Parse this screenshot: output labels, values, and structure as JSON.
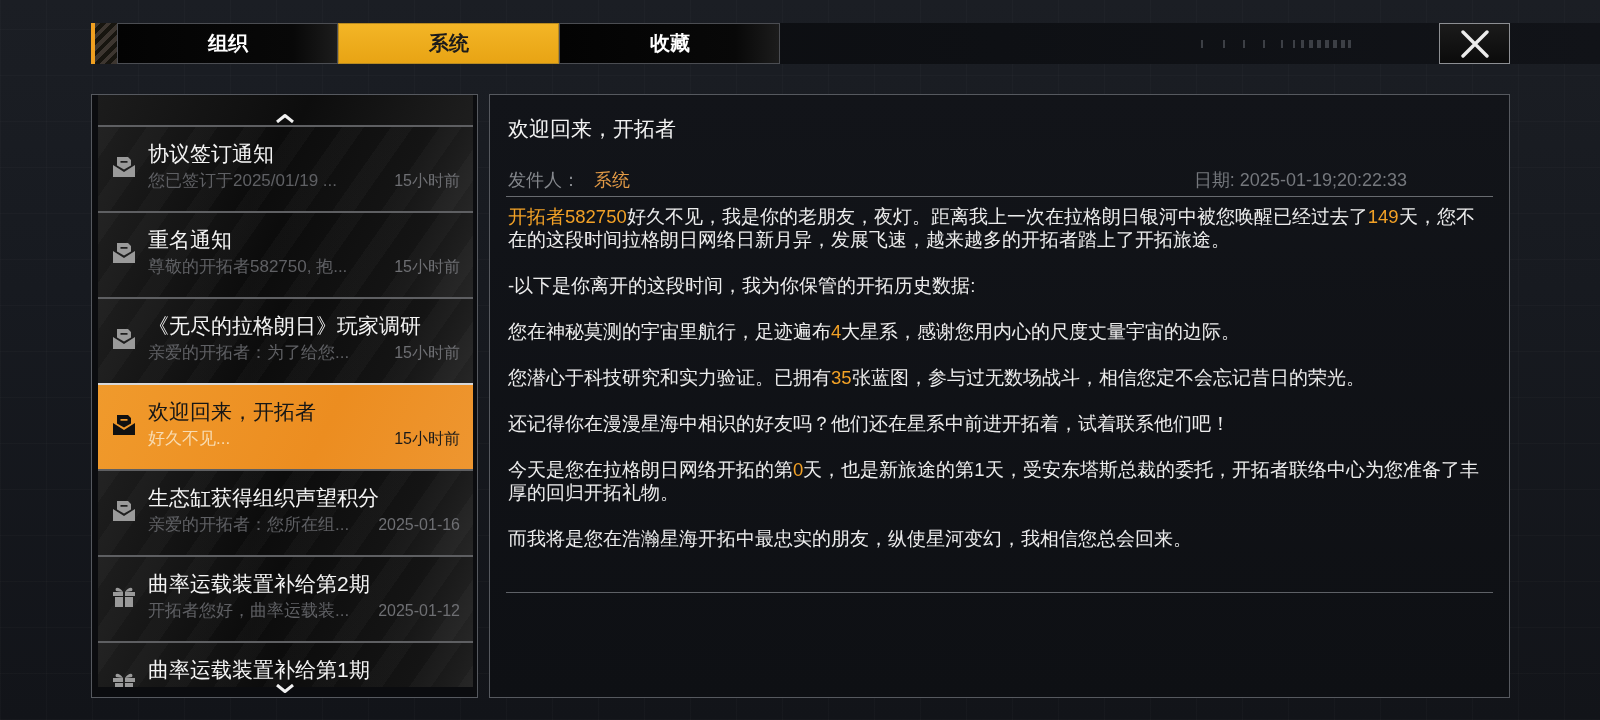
{
  "tabs": [
    {
      "label": "组织",
      "selected": false
    },
    {
      "label": "系统",
      "selected": true
    },
    {
      "label": "收藏",
      "selected": false
    }
  ],
  "mail_list": {
    "items": [
      {
        "kind": "mail",
        "title": "协议签订通知",
        "preview": "您已签订于2025/01/19 ...",
        "time": "15小时前",
        "selected": false
      },
      {
        "kind": "mail",
        "title": "重名通知",
        "preview": "尊敬的开拓者582750, 抱...",
        "time": "15小时前",
        "selected": false
      },
      {
        "kind": "mail",
        "title": "《无尽的拉格朗日》玩家调研",
        "preview": "亲爱的开拓者：为了给您...",
        "time": "15小时前",
        "selected": false
      },
      {
        "kind": "mail",
        "title": "欢迎回来，开拓者",
        "preview": "好久不见...",
        "time": "15小时前",
        "selected": true
      },
      {
        "kind": "mail",
        "title": "生态缸获得组织声望积分",
        "preview": "亲爱的开拓者：您所在组...",
        "time": "2025-01-16",
        "selected": false
      },
      {
        "kind": "gift",
        "title": "曲率运载装置补给第2期",
        "preview": "开拓者您好，曲率运载装...",
        "time": "2025-01-12",
        "selected": false
      },
      {
        "kind": "gift",
        "title": "曲率运载装置补给第1期",
        "selected": false
      }
    ]
  },
  "message": {
    "title": "欢迎回来，开拓者",
    "sender_label": "发件人：",
    "sender": "系统",
    "date": "日期: 2025-01-19;20:22:33",
    "paragraphs": [
      {
        "segments": [
          {
            "text": "开拓者582750",
            "highlight": true
          },
          {
            "text": "好久不见，我是你的老朋友，夜灯。距离我上一次在拉格朗日银河中被您唤醒已经过去了",
            "highlight": false
          },
          {
            "text": "149",
            "highlight": true
          },
          {
            "text": "天，您不在的这段时间拉格朗日网络日新月异，发展飞速，越来越多的开拓者踏上了开拓旅途。",
            "highlight": false
          }
        ]
      },
      {
        "segments": [
          {
            "text": "-以下是你离开的这段时间，我为你保管的开拓历史数据:",
            "highlight": false
          }
        ]
      },
      {
        "segments": [
          {
            "text": "您在神秘莫测的宇宙里航行，足迹遍布",
            "highlight": false
          },
          {
            "text": "4",
            "highlight": true
          },
          {
            "text": "大星系，感谢您用内心的尺度丈量宇宙的边际。",
            "highlight": false
          }
        ]
      },
      {
        "segments": [
          {
            "text": "您潜心于科技研究和实力验证。已拥有",
            "highlight": false
          },
          {
            "text": "35",
            "highlight": true
          },
          {
            "text": "张蓝图，参与过无数场战斗，相信您定不会忘记昔日的荣光。",
            "highlight": false
          }
        ]
      },
      {
        "segments": [
          {
            "text": "还记得你在漫漫星海中相识的好友吗？他们还在星系中前进开拓着，试着联系他们吧！",
            "highlight": false
          }
        ]
      },
      {
        "segments": [
          {
            "text": "今天是您在拉格朗日网络开拓的第",
            "highlight": false
          },
          {
            "text": "0",
            "highlight": true
          },
          {
            "text": "天，也是新旅途的第1天，受安东塔斯总裁的委托，开拓者联络中心为您准备了丰厚的回归开拓礼物。",
            "highlight": false
          }
        ]
      },
      {
        "segments": [
          {
            "text": "而我将是您在浩瀚星海开拓中最忠实的朋友，纵使星河变幻，我相信您总会回来。",
            "highlight": false
          }
        ]
      }
    ]
  }
}
